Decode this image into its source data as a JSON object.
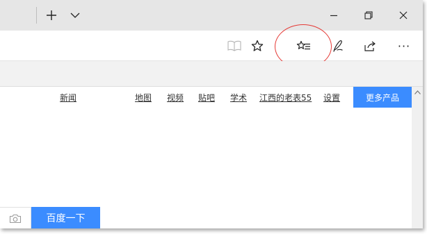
{
  "titlebar": {
    "new_tab_icon": "plus-icon",
    "tab_list_icon": "chevron-down-icon",
    "minimize_icon": "minimize-icon",
    "restore_icon": "restore-icon",
    "close_icon": "close-icon"
  },
  "toolbar": {
    "icons": [
      "reading-view-icon",
      "favorite-star-icon",
      "favorites-hub-icon",
      "web-note-icon",
      "share-icon",
      "more-icon"
    ],
    "more_label": "···"
  },
  "annotation": {
    "color": "#e53935"
  },
  "page": {
    "nav_links": [
      "新闻",
      "地图",
      "视频",
      "贴吧",
      "学术",
      "江西的老表55",
      "设置"
    ],
    "more_products": "更多产品",
    "search_button": "百度一下",
    "accent_color": "#3b8cff"
  }
}
